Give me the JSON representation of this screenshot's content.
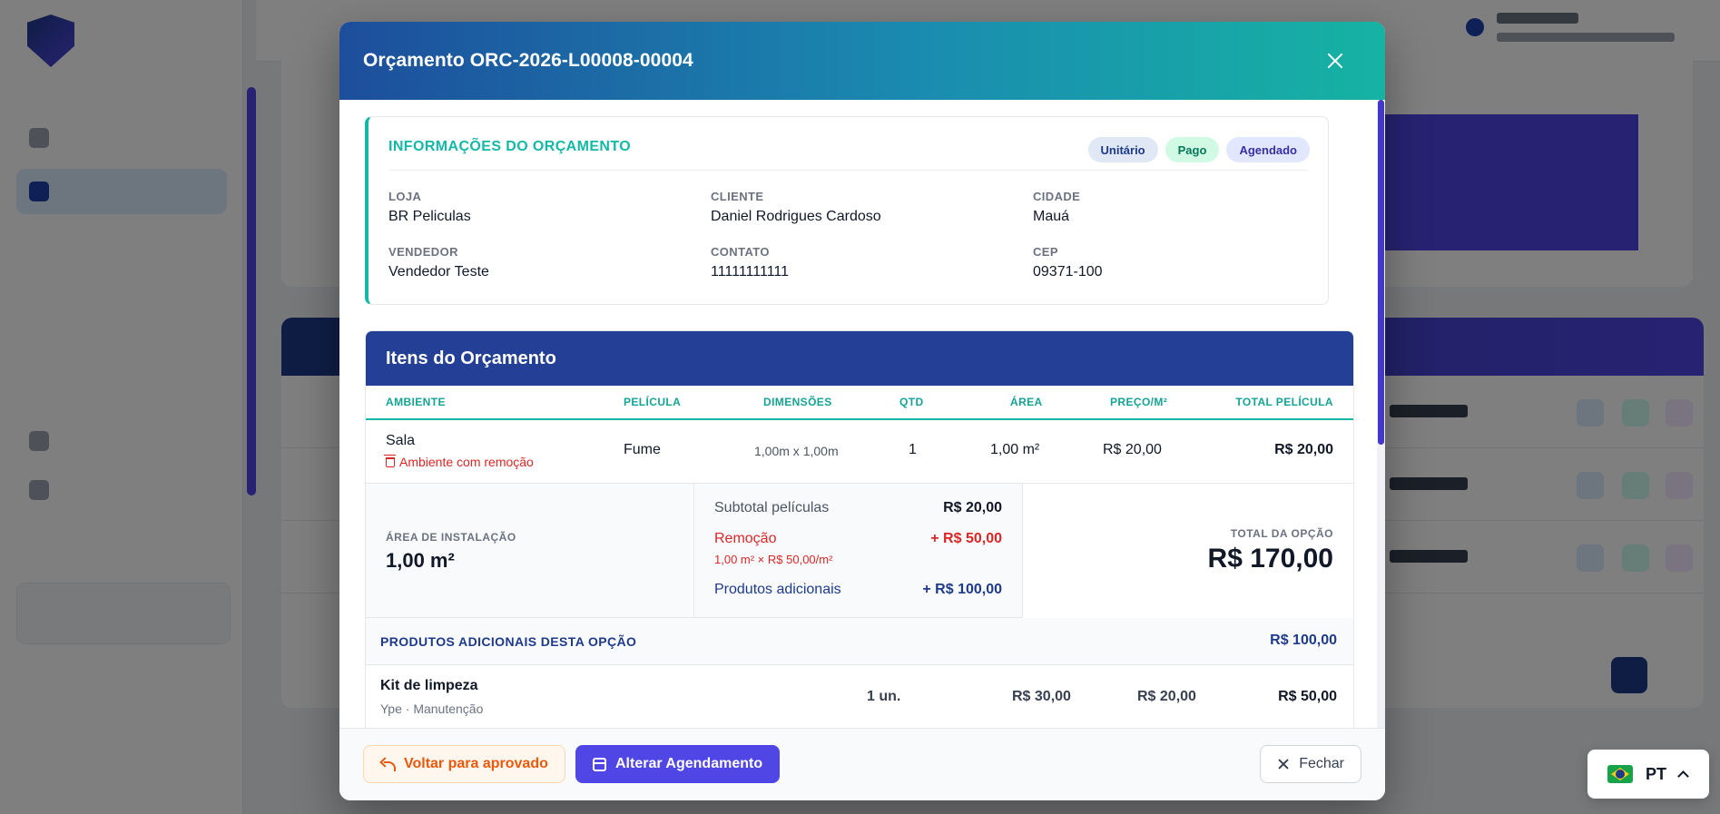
{
  "modal": {
    "title": "Orçamento ORC-2026-L00008-00004"
  },
  "info": {
    "title": "INFORMAÇÕES DO ORÇAMENTO",
    "badges": [
      "Unitário",
      "Pago",
      "Agendado"
    ],
    "fields": {
      "loja": {
        "label": "LOJA",
        "value": "BR Peliculas"
      },
      "cliente": {
        "label": "CLIENTE",
        "value": "Daniel Rodrigues Cardoso"
      },
      "cidade": {
        "label": "CIDADE",
        "value": "Mauá"
      },
      "vendedor": {
        "label": "VENDEDOR",
        "value": "Vendedor Teste"
      },
      "contato": {
        "label": "CONTATO",
        "value": "11111111111"
      },
      "cep": {
        "label": "CEP",
        "value": "09371-100"
      }
    }
  },
  "items": {
    "title": "Itens do Orçamento",
    "columns": [
      "AMBIENTE",
      "PELÍCULA",
      "DIMENSÕES",
      "QTD",
      "ÁREA",
      "PREÇO/M²",
      "TOTAL PELÍCULA"
    ],
    "rows": [
      {
        "ambiente": "Sala",
        "removal_tag": "Ambiente com remoção",
        "pelicula": "Fume",
        "dimensoes": "1,00m x 1,00m",
        "qtd": "1",
        "area": "1,00 m²",
        "preco_m2": "R$ 20,00",
        "total": "R$ 20,00"
      }
    ]
  },
  "summary": {
    "area_label": "ÁREA DE INSTALAÇÃO",
    "area_value": "1,00 m²",
    "subtotal_label": "Subtotal películas",
    "subtotal_value": "R$ 20,00",
    "removal_label": "Remoção",
    "removal_value": "+ R$ 50,00",
    "removal_detail": "1,00 m² × R$ 50,00/m²",
    "addl_label": "Produtos adicionais",
    "addl_value": "+ R$ 100,00",
    "total_label": "TOTAL DA OPÇÃO",
    "total_value": "R$ 170,00"
  },
  "additional": {
    "title": "PRODUTOS ADICIONAIS DESTA OPÇÃO",
    "total": "R$ 100,00",
    "rows": [
      {
        "name": "Kit de limpeza",
        "sub": "Ype · Manutenção",
        "qty": "1 un.",
        "c1": "R$ 30,00",
        "c2": "R$ 20,00",
        "total": "R$ 50,00"
      }
    ]
  },
  "footer": {
    "back_label": "Voltar para aprovado",
    "schedule_label": "Alterar Agendamento",
    "close_label": "Fechar"
  },
  "lang": {
    "code": "PT"
  },
  "colors": {
    "accent_teal": "#14b8a6",
    "primary_blue": "#243f96",
    "primary_indigo": "#4f46e5",
    "danger": "#dc2626"
  }
}
